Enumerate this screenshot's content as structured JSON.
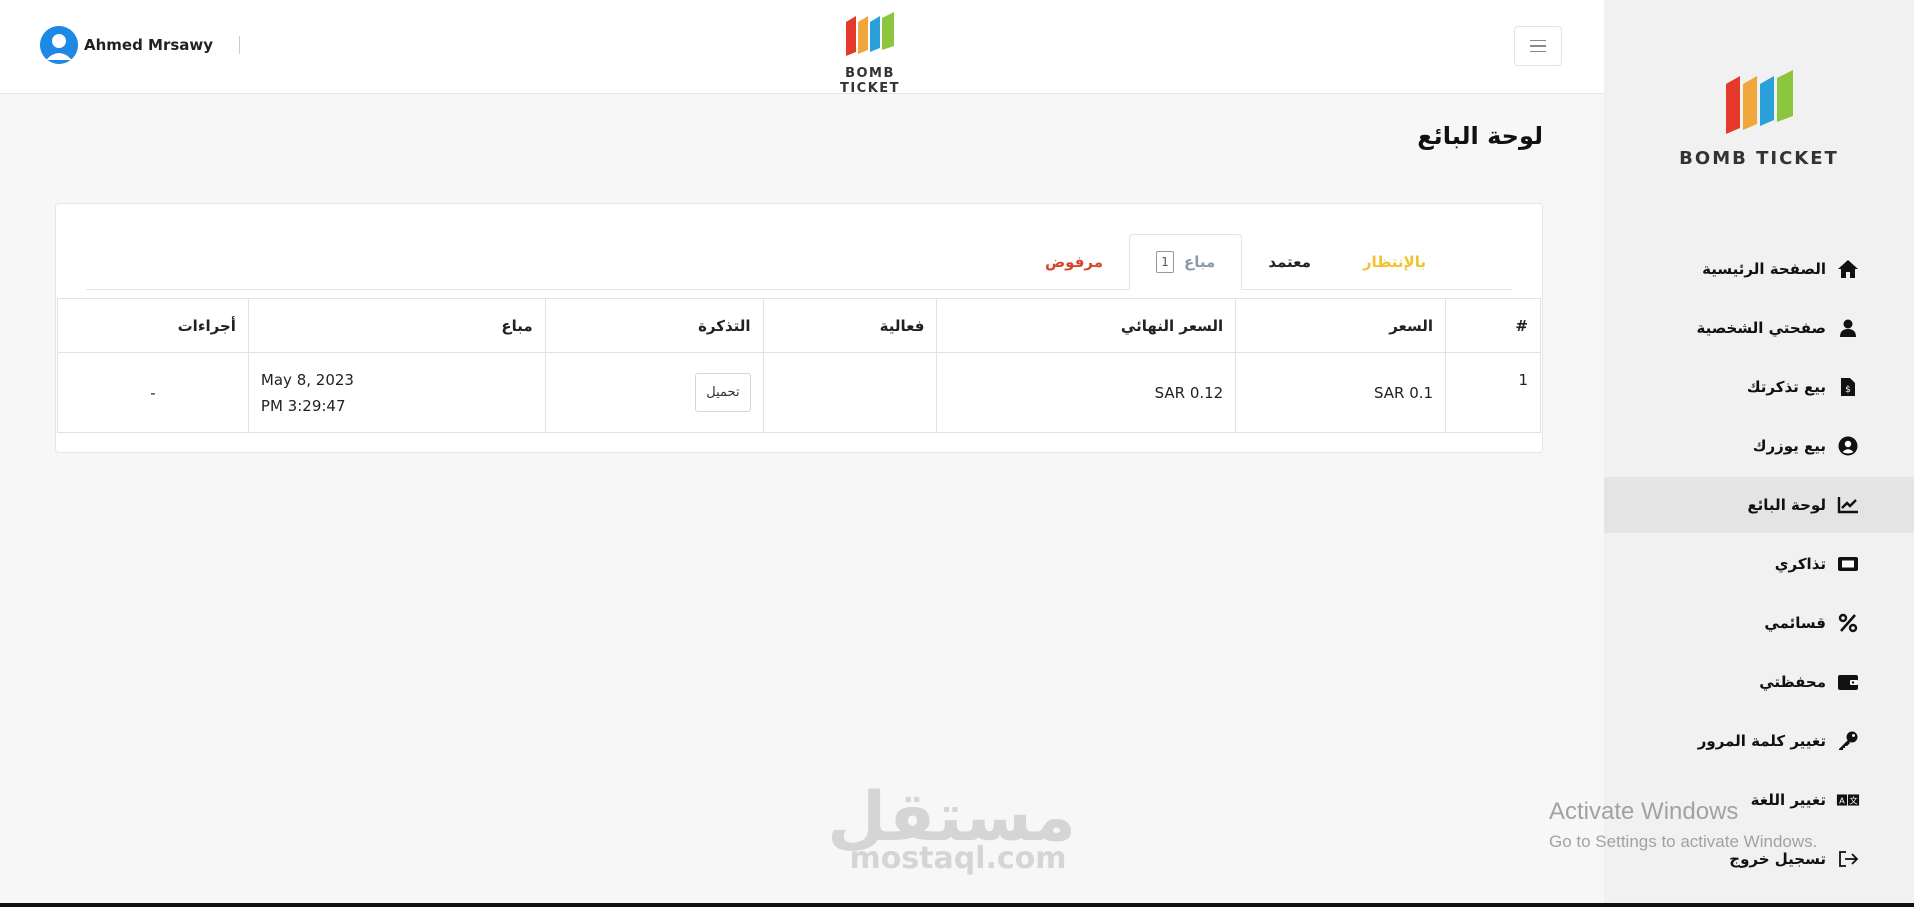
{
  "brand": {
    "name": "BOMB TICKET",
    "colors": [
      "#e5392b",
      "#f0a63a",
      "#2a9fd8",
      "#8cc63f"
    ]
  },
  "header": {
    "user_name": "Ahmed Mrsawy",
    "menu_icon": "hamburger-icon"
  },
  "page": {
    "title": "لوحة البائع"
  },
  "tabs": {
    "pending": "بالإنتظار",
    "approved": "معتمد",
    "sold": "مباع",
    "sold_count": "1",
    "rejected": "مرفوض"
  },
  "table": {
    "headers": [
      "#",
      "السعر",
      "السعر النهائي",
      "فعالية",
      "التذكرة",
      "مباع",
      "أجراءات"
    ],
    "rows": [
      {
        "num": "1",
        "price": "SAR 0.1",
        "final_price": "SAR 0.12",
        "event": "",
        "ticket_button": "تحميل",
        "sold_date": "May 8, 2023",
        "sold_time": "PM 3:29:47",
        "actions": "-"
      }
    ]
  },
  "sidebar": {
    "items": [
      {
        "label": "الصفحة الرئيسية",
        "icon": "home-icon"
      },
      {
        "label": "صفحتي الشخصية",
        "icon": "user-icon"
      },
      {
        "label": "بيع تذكرتك",
        "icon": "file-invoice-icon"
      },
      {
        "label": "بيع يوزرك",
        "icon": "user-circle-icon"
      },
      {
        "label": "لوحة البائع",
        "icon": "chart-line-icon",
        "active": true
      },
      {
        "label": "تذاكري",
        "icon": "ticket-icon"
      },
      {
        "label": "قسائمي",
        "icon": "percent-icon"
      },
      {
        "label": "محفظتي",
        "icon": "wallet-icon"
      },
      {
        "label": "تغيير كلمة المرور",
        "icon": "key-icon"
      },
      {
        "label": "تغيير اللغة",
        "icon": "language-icon"
      },
      {
        "label": "تسجيل خروج",
        "icon": "logout-icon"
      }
    ]
  },
  "watermark": {
    "mostaql_ar": "مستقل",
    "mostaql_en": "mostaql.com",
    "activate_title": "Activate Windows",
    "activate_sub": "Go to Settings to activate Windows."
  }
}
